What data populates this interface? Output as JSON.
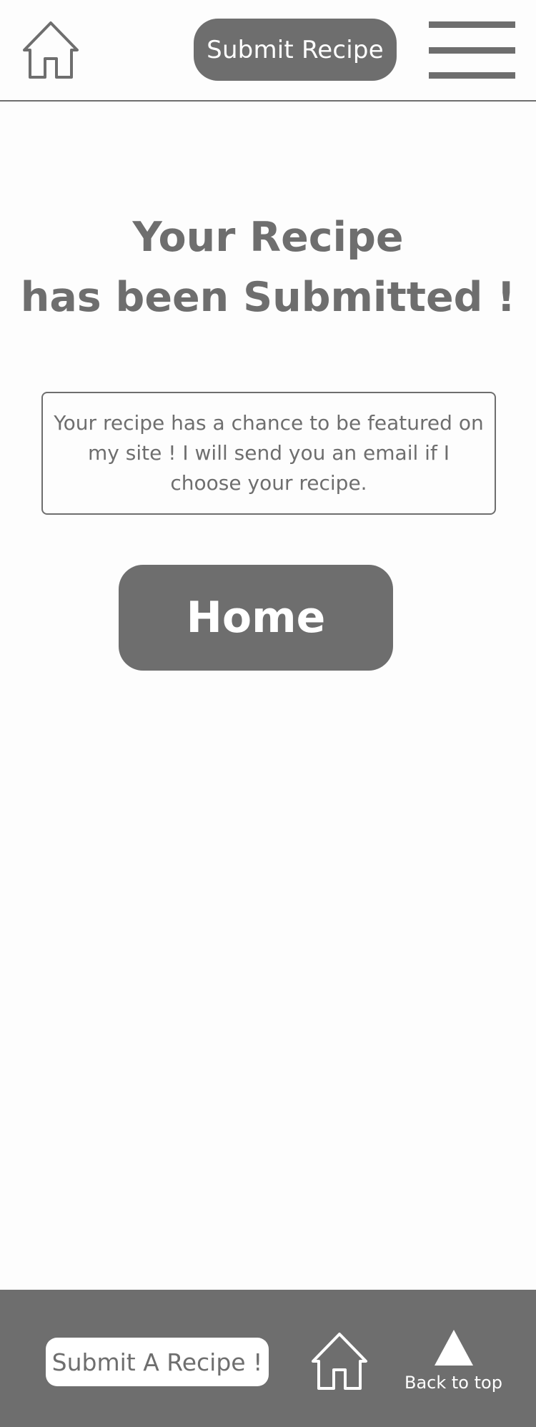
{
  "header": {
    "home_icon": "home-icon",
    "submit_label": "Submit Recipe",
    "menu_icon": "hamburger-menu-icon"
  },
  "main": {
    "title_line1": "Your Recipe",
    "title_line2": "has been Submitted !",
    "message": "Your recipe has a chance to be featured on my site ! I will send you an email if I choose your recipe.",
    "home_button_label": "Home"
  },
  "footer": {
    "submit_label": "Submit A Recipe !",
    "home_icon": "home-icon",
    "back_to_top_label": "Back to top",
    "back_to_top_icon": "triangle-up-icon"
  },
  "colors": {
    "primary_gray": "#6e6e6e",
    "background": "#fdfdfd",
    "white": "#ffffff"
  }
}
